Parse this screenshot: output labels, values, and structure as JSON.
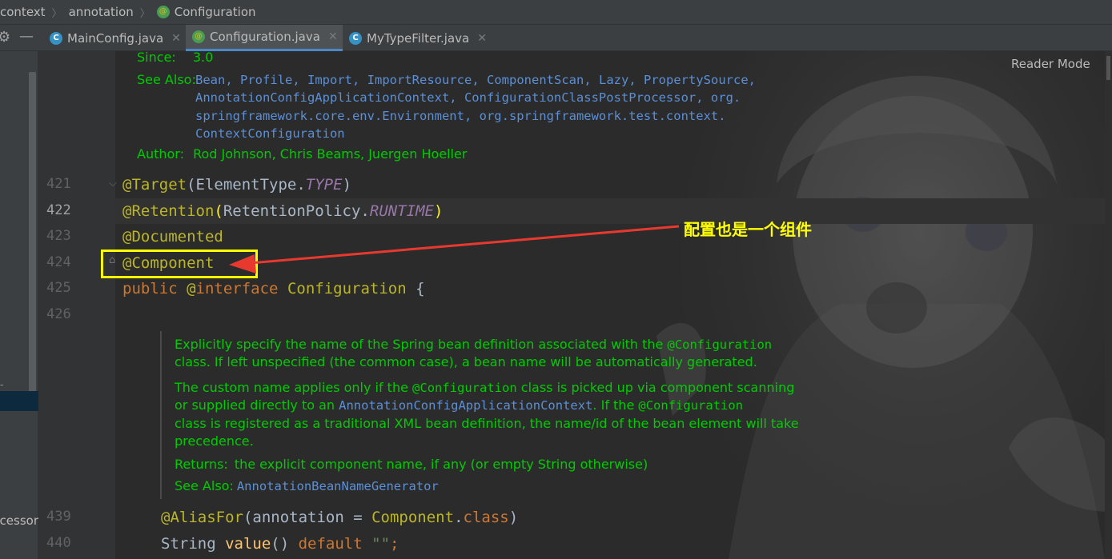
{
  "breadcrumb": {
    "items": [
      "context",
      "annotation",
      "Configuration"
    ]
  },
  "tabs": [
    {
      "label": "MainConfig.java",
      "icon": "class-icon",
      "active": false
    },
    {
      "label": "Configuration.java",
      "icon": "annotation-icon",
      "active": true
    },
    {
      "label": "MyTypeFilter.java",
      "icon": "class-icon",
      "active": false
    }
  ],
  "reader_mode_label": "Reader Mode",
  "left_panel": {
    "truncated_item": "ocessor"
  },
  "doc_top": {
    "since_label": "Since:",
    "since_value": "3.0",
    "see_also_label": "See Also:",
    "see_also_line1": [
      "Bean",
      "Profile",
      "Import",
      "ImportResource",
      "ComponentScan",
      "Lazy",
      "PropertySource"
    ],
    "see_also_line2_a": "AnnotationConfigApplicationContext",
    "see_also_line2_b": "ConfigurationClassPostProcessor",
    "see_also_line2_c": "org.",
    "see_also_line3_a": "springframework.core.env.Environment",
    "see_also_line3_b": "org.springframework.test.context.",
    "see_also_line4": "ContextConfiguration",
    "author_label": "Author:",
    "author_value": "Rod Johnson, Chris Beams, Juergen Hoeller"
  },
  "lines": {
    "n421": "421",
    "n422": "422",
    "n423": "423",
    "n424": "424",
    "n425": "425",
    "n426": "426",
    "n439": "439",
    "n440": "440"
  },
  "code": {
    "l421_anno": "@Target",
    "l421_open": "(ElementType.",
    "l421_const": "TYPE",
    "l421_close": ")",
    "l422_anno": "@Retention",
    "l422_open": "(",
    "l422_mid": "RetentionPolicy.",
    "l422_const": "RUNTIME",
    "l422_close": ")",
    "l423": "@Documented",
    "l424": "@Component",
    "l425_kw": "public",
    "l425_at": "@",
    "l425_kw2": "interface",
    "l425_name": "Configuration",
    "l425_brace": " {",
    "l439_anno": "@AliasFor",
    "l439_a": "(annotation = ",
    "l439_b": "Component",
    "l439_c": ".",
    "l439_d": "class",
    "l439_e": ")",
    "l440_type": "String ",
    "l440_method": "value",
    "l440_paren": "() ",
    "l440_kw": "default",
    "l440_str": " \"\"",
    "l440_semi": ";"
  },
  "doc_mid": {
    "p1_a": "Explicitly specify the name of the Spring bean definition associated with the ",
    "p1_code": "@Configuration",
    "p1_b": "class. If left unspecified (the common case), a bean name will be automatically generated.",
    "p2_a": "The custom name applies only if the ",
    "p2_code": "@Configuration",
    "p2_b": " class is picked up via component scanning",
    "p2_c": "or supplied directly to an ",
    "p2_link": "AnnotationConfigApplicationContext",
    "p2_d": ". If the ",
    "p2_code2": "@Configuration",
    "p2_e": "class is registered as a traditional XML bean definition, the name/id of the bean element will take",
    "p2_f": "precedence.",
    "returns_label": "Returns:",
    "returns_value": "the explicit component name, if any (or empty String otherwise)",
    "see_also_label": "See Also:",
    "see_also_link": "AnnotationBeanNameGenerator"
  },
  "callout_text": "配置也是一个组件",
  "colors": {
    "annotation": "#bbb529",
    "keyword": "#cc7832",
    "constant": "#9876aa",
    "doc_text": "#00cc00",
    "doc_link": "#5b8fd6",
    "highlight": "#ffff00",
    "arrow": "#e8392f"
  }
}
